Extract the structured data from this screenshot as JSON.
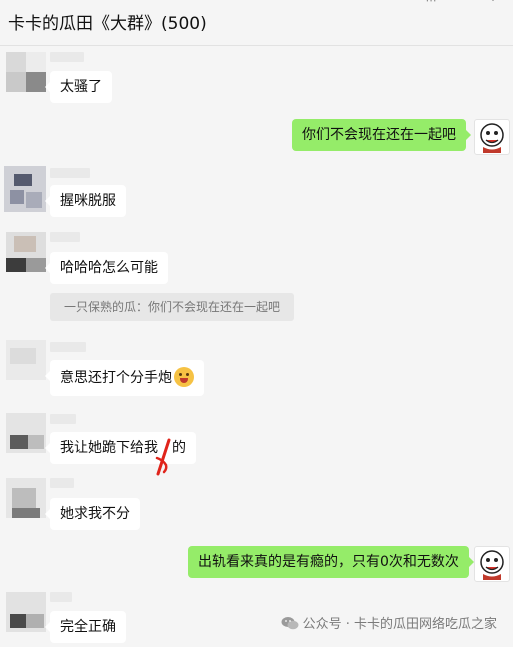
{
  "header": {
    "title": "卡卡的瓜田《大群》(500)"
  },
  "messages": [
    {
      "side": "left",
      "text": "太骚了"
    },
    {
      "side": "right",
      "text": "你们不会现在还在一起吧"
    },
    {
      "side": "left",
      "text": "握咪脱服"
    },
    {
      "side": "left",
      "text": "哈哈哈怎么可能",
      "quote": "一只保熟的瓜：你们不会现在还在一起吧"
    },
    {
      "side": "left",
      "text": "意思还打个分手炮",
      "emoji": "grinning-face-emoji"
    },
    {
      "side": "left",
      "text_before": "我让她跪下给我",
      "text_after": "的",
      "hidden_char": ""
    },
    {
      "side": "left",
      "text": "她求我不分"
    },
    {
      "side": "right",
      "text": "出轨看来真的是有瘾的，只有0次和无数次"
    },
    {
      "side": "left",
      "text": "完全正确"
    }
  ],
  "watermark": {
    "icon": "wechat-icon",
    "text": "公众号 · 卡卡的瓜田网络吃瓜之家"
  },
  "colors": {
    "background": "#f5f5f5",
    "incoming_bubble": "#ffffff",
    "outgoing_bubble": "#95ec69",
    "annotation_red": "#e0241b"
  }
}
